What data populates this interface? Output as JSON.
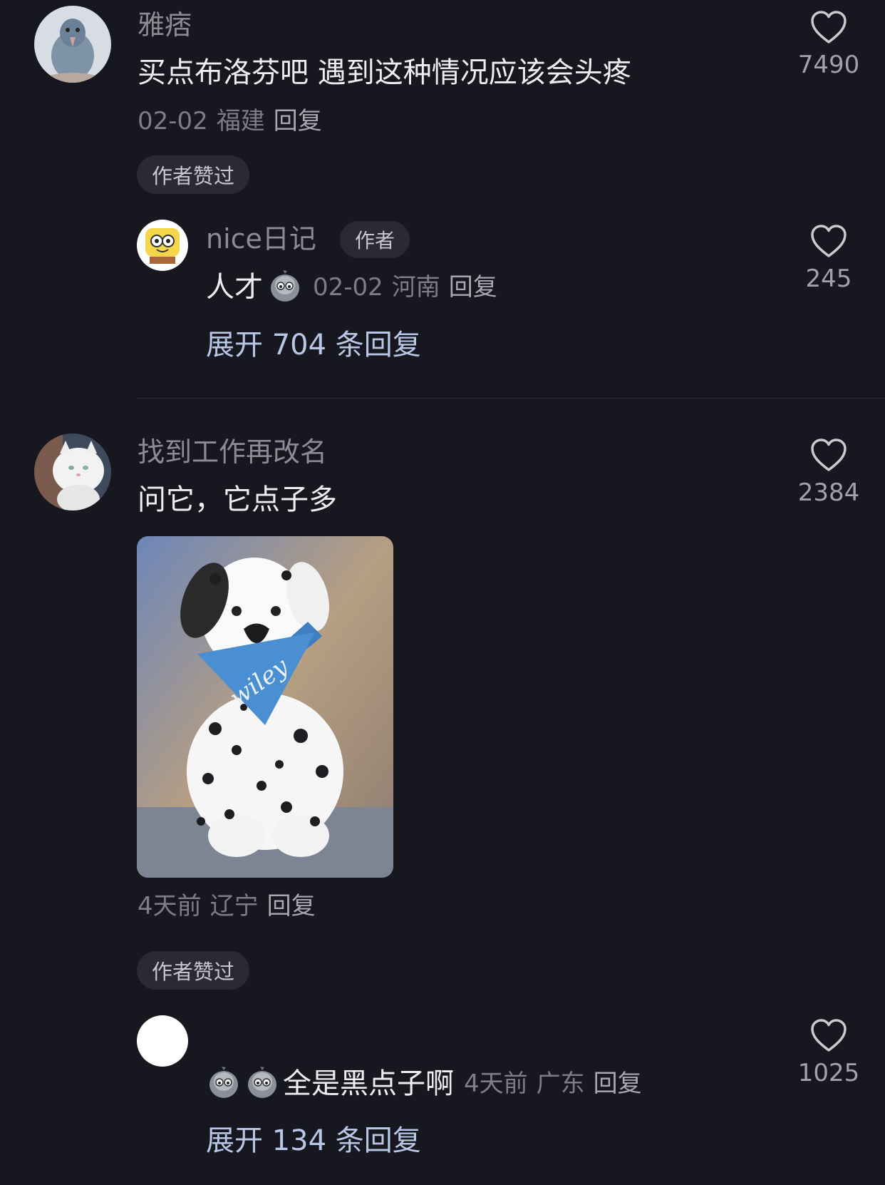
{
  "comments": [
    {
      "username": "雅痞",
      "content": "买点布洛芬吧  遇到这种情况应该会头疼",
      "date": "02-02",
      "location": "福建",
      "reply_label": "回复",
      "likes": "7490",
      "badge": "作者赞过",
      "sub_reply": {
        "username": "nice日记",
        "author_tag": "作者",
        "content": "人才",
        "emoji": "pigeon-emoji",
        "date": "02-02",
        "location": "河南",
        "reply_label": "回复",
        "likes": "245"
      },
      "expand_label": "展开 704 条回复"
    },
    {
      "username": "找到工作再改名",
      "content": "问它，它点子多",
      "image_text": "wiley",
      "date": "4天前",
      "location": "辽宁",
      "reply_label": "回复",
      "likes": "2384",
      "badge": "作者赞过",
      "sub_reply": {
        "username": "",
        "content": "全是黑点子啊",
        "emoji": "pigeon-emoji",
        "date": "4天前",
        "location": "广东",
        "reply_label": "回复",
        "likes": "1025"
      },
      "expand_label": "展开 134 条回复"
    }
  ],
  "colors": {
    "background": "#17171f",
    "expand_link": "#b9c7e6",
    "chip_bg": "#2a2a33"
  },
  "icons": [
    "heart-outline-icon",
    "pigeon-emoji"
  ]
}
